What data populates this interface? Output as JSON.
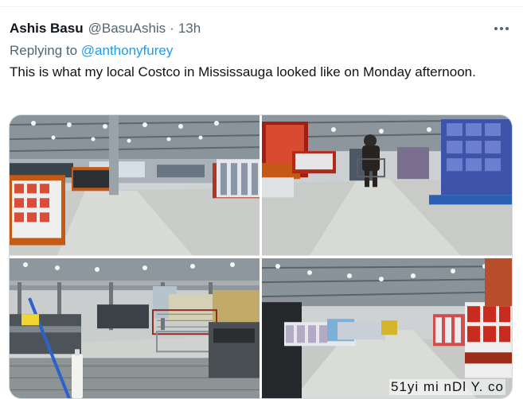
{
  "tweet": {
    "author_name": "Ashis Basu",
    "author_handle": "@BasuAshis",
    "separator": "·",
    "time": "13h",
    "replying_prefix": "Replying to ",
    "replying_handle": "@anthonyfurey",
    "text": "This is what my local Costco in Mississauga looked like on Monday afternoon."
  },
  "media": {
    "photos": [
      {
        "description": "Costco warehouse aisle with TV displays and boxes"
      },
      {
        "description": "Costco aisle with shopper pushing cart"
      },
      {
        "description": "Costco checkout lanes with empty carts"
      },
      {
        "description": "Costco wide aisle with stacked merchandise"
      }
    ]
  },
  "watermark": "51yi mi nDl Y. co",
  "icons": {
    "more": "more-icon"
  }
}
